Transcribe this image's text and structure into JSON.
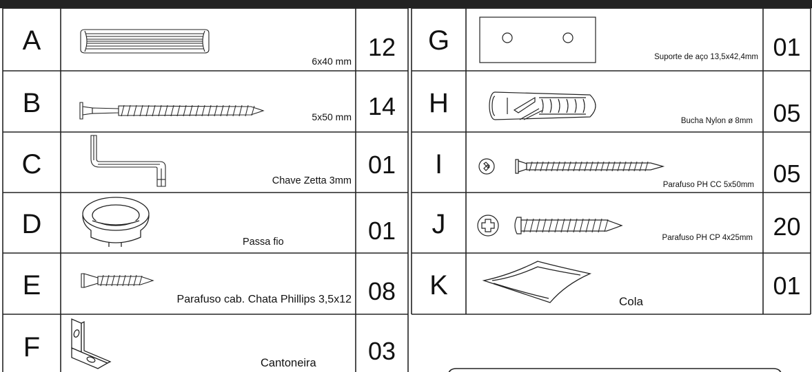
{
  "parts_left": [
    {
      "letter": "A",
      "desc": "6x40 mm",
      "qty": "12",
      "icon": "wood-dowel-icon"
    },
    {
      "letter": "B",
      "desc": "5x50 mm",
      "qty": "14",
      "icon": "confirmat-screw-icon"
    },
    {
      "letter": "C",
      "desc": "Chave Zetta 3mm",
      "qty": "01",
      "icon": "allen-key-icon"
    },
    {
      "letter": "D",
      "desc": "Passa fio",
      "qty": "01",
      "icon": "cable-grommet-icon"
    },
    {
      "letter": "E",
      "desc": "Parafuso cab. Chata Phillips 3,5x12",
      "qty": "08",
      "icon": "flat-head-screw-icon"
    },
    {
      "letter": "F",
      "desc": "Cantoneira",
      "qty": "03",
      "icon": "corner-bracket-icon"
    }
  ],
  "parts_right": [
    {
      "letter": "G",
      "desc": "Suporte de aço 13,5x42,4mm",
      "qty": "01",
      "icon": "steel-bracket-plate-icon"
    },
    {
      "letter": "H",
      "desc": "Bucha Nylon ø 8mm",
      "qty": "05",
      "icon": "nylon-wall-plug-icon"
    },
    {
      "letter": "I",
      "desc": "Parafuso PH CC 5x50mm",
      "qty": "05",
      "icon": "countersunk-screw-icon"
    },
    {
      "letter": "J",
      "desc": "Parafuso PH CP 4x25mm",
      "qty": "20",
      "icon": "pan-head-screw-icon"
    },
    {
      "letter": "K",
      "desc": "Cola",
      "qty": "01",
      "icon": "glue-sachet-icon"
    }
  ]
}
